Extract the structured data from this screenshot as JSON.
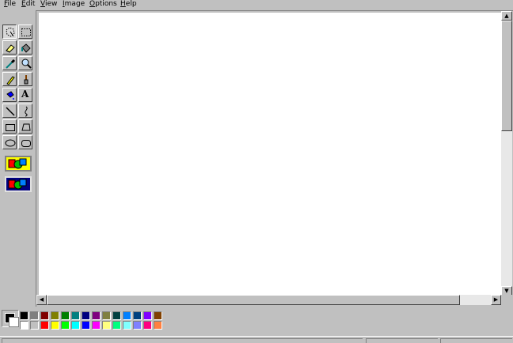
{
  "menu": [
    {
      "label": "File",
      "underline": "F",
      "rest": "ile"
    },
    {
      "label": "Edit",
      "underline": "E",
      "rest": "dit"
    },
    {
      "label": "View",
      "underline": "V",
      "rest": "iew"
    },
    {
      "label": "Image",
      "underline": "I",
      "rest": "mage"
    },
    {
      "label": "Options",
      "underline": "O",
      "rest": "ptions"
    },
    {
      "label": "Help",
      "underline": "H",
      "rest": "elp"
    }
  ],
  "tools": [
    {
      "name": "free-form-select-tool",
      "icon": "free-form-select-icon",
      "pressed": true
    },
    {
      "name": "select-tool",
      "icon": "select-rectangle-icon"
    },
    {
      "name": "eraser-tool",
      "icon": "eraser-icon"
    },
    {
      "name": "fill-tool",
      "icon": "paint-bucket-icon"
    },
    {
      "name": "pick-color-tool",
      "icon": "eyedropper-icon"
    },
    {
      "name": "magnifier-tool",
      "icon": "magnifier-icon"
    },
    {
      "name": "pencil-tool",
      "icon": "pencil-icon"
    },
    {
      "name": "brush-tool",
      "icon": "brush-icon"
    },
    {
      "name": "airbrush-tool",
      "icon": "airbrush-icon"
    },
    {
      "name": "text-tool",
      "icon": "text-a-icon",
      "glyph": "A"
    },
    {
      "name": "line-tool",
      "icon": "line-icon"
    },
    {
      "name": "curve-tool",
      "icon": "curve-icon"
    },
    {
      "name": "rectangle-tool",
      "icon": "rectangle-icon"
    },
    {
      "name": "polygon-tool",
      "icon": "polygon-icon"
    },
    {
      "name": "ellipse-tool",
      "icon": "ellipse-icon"
    },
    {
      "name": "rounded-rectangle-tool",
      "icon": "rounded-rectangle-icon"
    }
  ],
  "tool_options": [
    {
      "name": "opaque-option",
      "icon": "opaque-transparency-icon"
    },
    {
      "name": "transparent-option",
      "icon": "transparent-transparency-icon"
    }
  ],
  "colors": {
    "foreground": "#000000",
    "background": "#ffffff",
    "palette_row1": [
      "#000000",
      "#808080",
      "#800000",
      "#808000",
      "#008000",
      "#008080",
      "#000080",
      "#800080",
      "#808040",
      "#004040",
      "#0080ff",
      "#004080",
      "#8000ff",
      "#804000"
    ],
    "palette_row2": [
      "#ffffff",
      "#c0c0c0",
      "#ff0000",
      "#ffff00",
      "#00ff00",
      "#00ffff",
      "#0000ff",
      "#ff00ff",
      "#ffff80",
      "#00ff80",
      "#80ffff",
      "#8080ff",
      "#ff0080",
      "#ff8040"
    ]
  },
  "scroll": {
    "up_arrow": "▲",
    "down_arrow": "▼",
    "left_arrow": "◀",
    "right_arrow": "▶"
  }
}
